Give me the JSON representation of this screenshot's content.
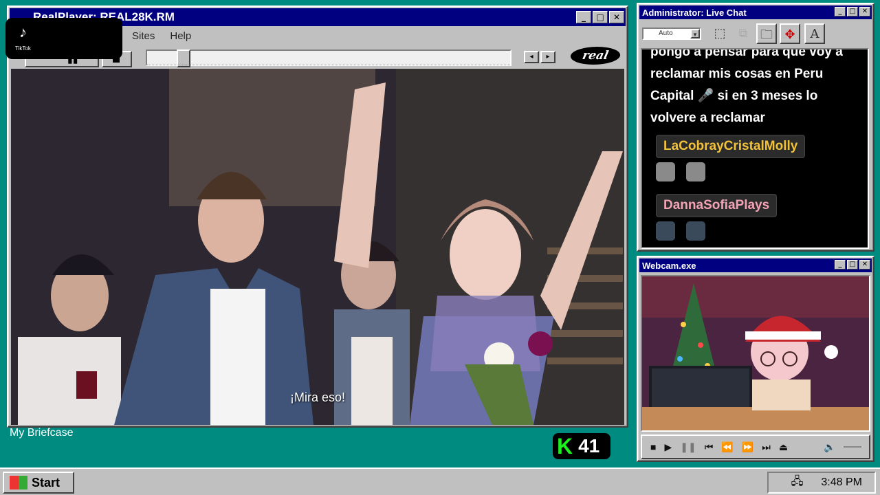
{
  "player": {
    "title": "RealPlayer: REAL28K.RM",
    "menu": [
      "Sites",
      "Help"
    ],
    "logo_text": "real",
    "subtitle": "¡Mira eso!",
    "progress_percent": 8.5
  },
  "tiktok": {
    "label": "TikTok"
  },
  "chat": {
    "title": "Administrator: Live Chat",
    "font_combo": "Auto",
    "tool_text_glyph": "A",
    "message": "pongo a pensar para que voy a reclamar mis cosas en Peru Capital 🎤 si en 3 meses lo volvere a reclamar",
    "users": [
      {
        "name": "LaCobrayCristalMolly",
        "color": "#f2c23a"
      },
      {
        "name": "DannaSofiaPlays",
        "color": "#f3a3b5"
      }
    ]
  },
  "webcam": {
    "title": "Webcam.exe"
  },
  "desktop": {
    "briefcase_label": "My Briefcase",
    "badge_count": "41",
    "badge_letter": "K"
  },
  "taskbar": {
    "start_label": "Start",
    "clock": "3:48 PM"
  },
  "colors": {
    "desktop": "#008b80",
    "titlebar": "#000080",
    "badge_green": "#1cf11c"
  }
}
